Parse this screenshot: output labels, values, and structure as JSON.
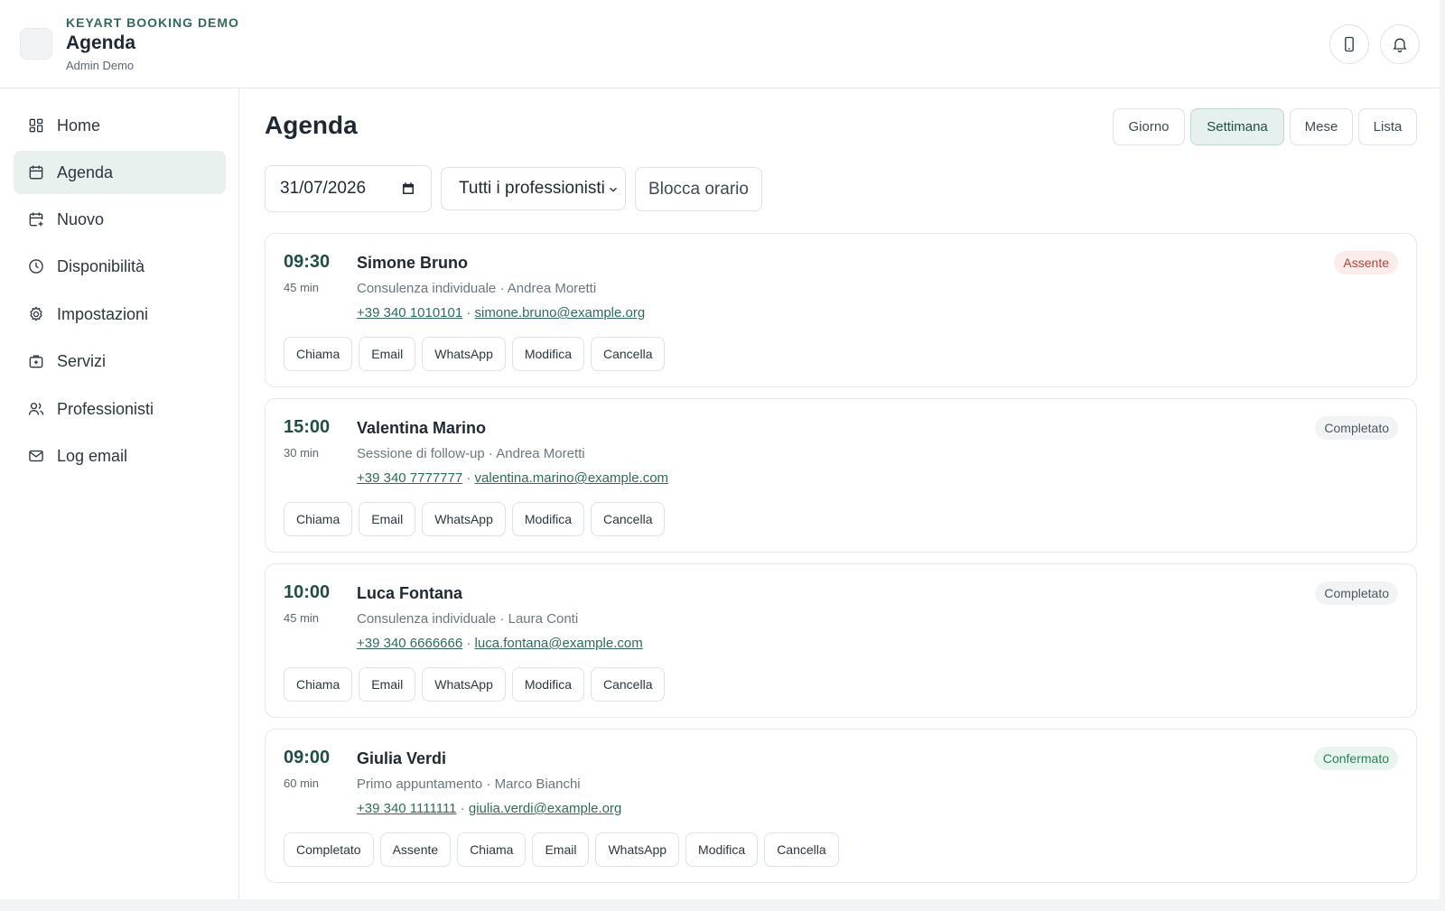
{
  "header": {
    "brand": "KEYART BOOKING DEMO",
    "title": "Agenda",
    "user": "Admin Demo",
    "icons": [
      "phone-icon",
      "bell-icon"
    ]
  },
  "sidebar": {
    "items": [
      {
        "label": "Home",
        "icon": "grid-icon",
        "active": false
      },
      {
        "label": "Agenda",
        "icon": "calendar-icon",
        "active": true
      },
      {
        "label": "Nuovo",
        "icon": "calendar-plus-icon",
        "active": false
      },
      {
        "label": "Disponibilità",
        "icon": "clock-icon",
        "active": false
      },
      {
        "label": "Impostazioni",
        "icon": "gear-icon",
        "active": false
      },
      {
        "label": "Servizi",
        "icon": "briefcase-icon",
        "active": false
      },
      {
        "label": "Professionisti",
        "icon": "users-icon",
        "active": false
      },
      {
        "label": "Log email",
        "icon": "mail-icon",
        "active": false
      }
    ]
  },
  "main": {
    "title": "Agenda",
    "views": [
      {
        "label": "Giorno",
        "active": false
      },
      {
        "label": "Settimana",
        "active": true
      },
      {
        "label": "Mese",
        "active": false
      },
      {
        "label": "Lista",
        "active": false
      }
    ],
    "filters": {
      "date": "31/07/2026",
      "professional": "Tutti i professionisti",
      "block_label": "Blocca orario"
    }
  },
  "appointments": [
    {
      "time": "09:30",
      "duration": "45 min",
      "name": "Simone Bruno",
      "service": "Consulenza individuale",
      "professional": "Andrea Moretti",
      "phone": "+39 340 1010101",
      "email": "simone.bruno@example.org",
      "status": "Assente",
      "status_key": "assente",
      "actions": [
        "Chiama",
        "Email",
        "WhatsApp",
        "Modifica",
        "Cancella"
      ]
    },
    {
      "time": "15:00",
      "duration": "30 min",
      "name": "Valentina Marino",
      "service": "Sessione di follow-up",
      "professional": "Andrea Moretti",
      "phone": "+39 340 7777777",
      "email": "valentina.marino@example.com",
      "status": "Completato",
      "status_key": "completato",
      "actions": [
        "Chiama",
        "Email",
        "WhatsApp",
        "Modifica",
        "Cancella"
      ]
    },
    {
      "time": "10:00",
      "duration": "45 min",
      "name": "Luca Fontana",
      "service": "Consulenza individuale",
      "professional": "Laura Conti",
      "phone": "+39 340 6666666",
      "email": "luca.fontana@example.com",
      "status": "Completato",
      "status_key": "completato",
      "actions": [
        "Chiama",
        "Email",
        "WhatsApp",
        "Modifica",
        "Cancella"
      ]
    },
    {
      "time": "09:00",
      "duration": "60 min",
      "name": "Giulia Verdi",
      "service": "Primo appuntamento",
      "professional": "Marco Bianchi",
      "phone": "+39 340 1111111",
      "email": "giulia.verdi@example.org",
      "status": "Confermato",
      "status_key": "confermato",
      "actions": [
        "Completato",
        "Assente",
        "Chiama",
        "Email",
        "WhatsApp",
        "Modifica",
        "Cancella"
      ]
    }
  ],
  "separator": "·",
  "colors": {
    "accent": "#2e6b5c",
    "active_nav": "#e9f1ef",
    "assente": "#b2423a",
    "confermato": "#2e7d56"
  }
}
